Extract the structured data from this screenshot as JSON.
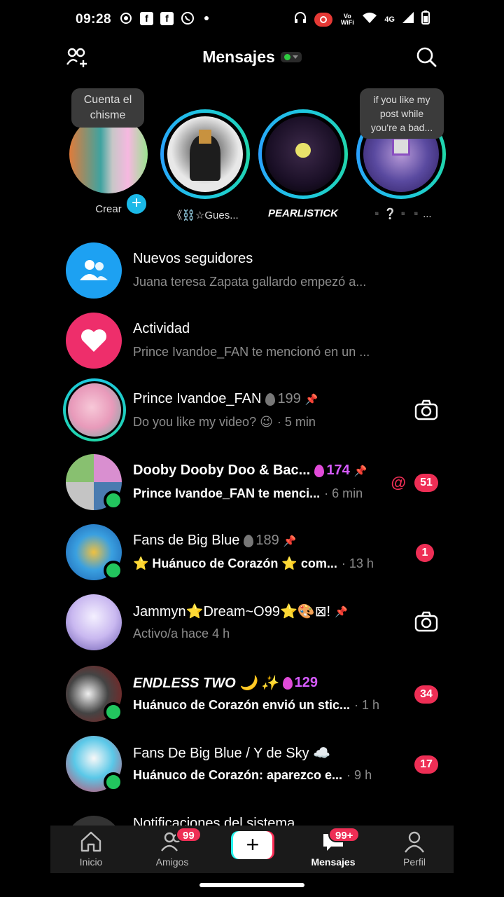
{
  "status_bar": {
    "time": "09:28",
    "vowifi": "Vo WiFi",
    "network": "4G"
  },
  "header": {
    "title": "Mensajes"
  },
  "stories": [
    {
      "name": "Crear",
      "bubble": "Cuenta el chisme"
    },
    {
      "name": "《⛓️☆Gues..."
    },
    {
      "name": "PEARLISTICK"
    },
    {
      "name": "▪️❔▪️▪️...",
      "bubble": "if you like my post while you're a bad..."
    }
  ],
  "rows": [
    {
      "title": "Nuevos seguidores",
      "sub": "Juana teresa Zapata gallardo empezó a..."
    },
    {
      "title": "Actividad",
      "sub": "Prince Ivandoe_FAN te mencionó en un ..."
    },
    {
      "title": "Prince Ivandoe_FAN",
      "streak": "199",
      "sub": "Do you like my video? 😉",
      "time": "· 5 min"
    },
    {
      "title": "Dooby Dooby Doo & Bac...",
      "streak": "174",
      "sub": "Prince Ivandoe_FAN te menci...",
      "time": "· 6 min",
      "badge": "51",
      "mention": "@"
    },
    {
      "title": "Fans de Big Blue",
      "streak": "189",
      "sub": "⭐ Huánuco de Corazón ⭐ com...",
      "time": "· 13 h",
      "badge": "1"
    },
    {
      "title": "Jammyn⭐Dream~O99⭐🎨⊠!",
      "sub": "Activo/a hace 4 h"
    },
    {
      "title": "ENDLESS TWO 🌙 ✨",
      "streak": "129",
      "sub": "Huánuco de Corazón envió un stic...",
      "time": "· 1 h",
      "badge": "34"
    },
    {
      "title": "Fans De Big Blue / Y de Sky ☁️",
      "sub": "Huánuco de Corazón: aparezco e...",
      "time": "· 9 h",
      "badge": "17"
    },
    {
      "title": "Notificaciones del sistema"
    }
  ],
  "nav": {
    "home": "Inicio",
    "friends": "Amigos",
    "friends_badge": "99",
    "messages": "Mensajes",
    "messages_badge": "99+",
    "profile": "Perfil"
  }
}
